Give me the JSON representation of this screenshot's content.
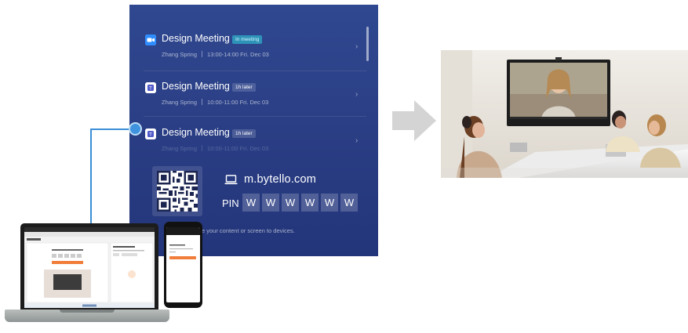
{
  "meetings": [
    {
      "title": "Design Meeting",
      "badge": "In meeting",
      "badge_type": "live",
      "organizer": "Zhang Spring",
      "time": "13:00-14:00 Fri. Dec 03"
    },
    {
      "title": "Design Meeting",
      "badge": "1h later",
      "badge_type": "later",
      "organizer": "Zhang Spring",
      "time": "10:00-11:00 Fri. Dec 03"
    },
    {
      "title": "Design Meeting",
      "badge": "1h later",
      "badge_type": "later",
      "organizer": "Zhang Spring",
      "time": "10:00-11:00 Fri. Dec 03"
    }
  ],
  "share": {
    "url": "m.bytello.com",
    "pin_label": "PIN",
    "pin": [
      "W",
      "W",
      "W",
      "W",
      "W",
      "W"
    ],
    "hint": "e your content or screen to devices."
  },
  "icons": {
    "meeting_app": "video-call-app-icon",
    "chevron": "chevron-right-icon",
    "laptop": "laptop-icon",
    "arrow": "arrow-right-icon"
  },
  "colors": {
    "panel": "#2b4189",
    "live_badge": "#2e93b8",
    "connector": "#3a8ed6",
    "accent_orange": "#f07d3a"
  }
}
